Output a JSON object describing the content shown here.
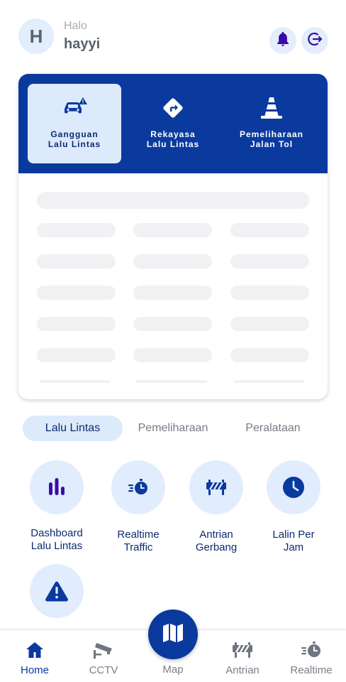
{
  "header": {
    "avatar_initial": "H",
    "greeting": "Halo",
    "username": "hayyi"
  },
  "categories": [
    {
      "label": "Gangguan\nLalu Lintas",
      "icon": "car-warning-icon",
      "active": true
    },
    {
      "label": "Rekayasa\nLalu Lintas",
      "icon": "detour-sign-icon",
      "active": false
    },
    {
      "label": "Pemeliharaan\nJalan Tol",
      "icon": "traffic-cone-icon",
      "active": false
    }
  ],
  "tabs": [
    {
      "label": "Lalu Lintas",
      "active": true
    },
    {
      "label": "Pemeliharaan",
      "active": false
    },
    {
      "label": "Peralataan",
      "active": false
    }
  ],
  "menu": [
    {
      "label": "Dashboard\nLalu Lintas",
      "icon": "bar-chart-icon"
    },
    {
      "label": "Realtime\nTraffic",
      "icon": "stopwatch-speed-icon"
    },
    {
      "label": "Antrian\nGerbang",
      "icon": "barrier-icon"
    },
    {
      "label": "Lalin Per\nJam",
      "icon": "clock-icon"
    },
    {
      "label": "",
      "icon": "warning-icon"
    }
  ],
  "bottom_nav": [
    {
      "label": "Home",
      "icon": "home-icon",
      "active": true
    },
    {
      "label": "CCTV",
      "icon": "cctv-icon",
      "active": false
    },
    {
      "label": "Map",
      "icon": "map-icon",
      "active": false
    },
    {
      "label": "Antrian",
      "icon": "barrier-icon",
      "active": false
    },
    {
      "label": "Realtime",
      "icon": "stopwatch-speed-icon",
      "active": false
    }
  ],
  "colors": {
    "primary": "#0b3a9e",
    "accent_purple": "#3a0ca3",
    "light_blue": "#e1edfc"
  }
}
